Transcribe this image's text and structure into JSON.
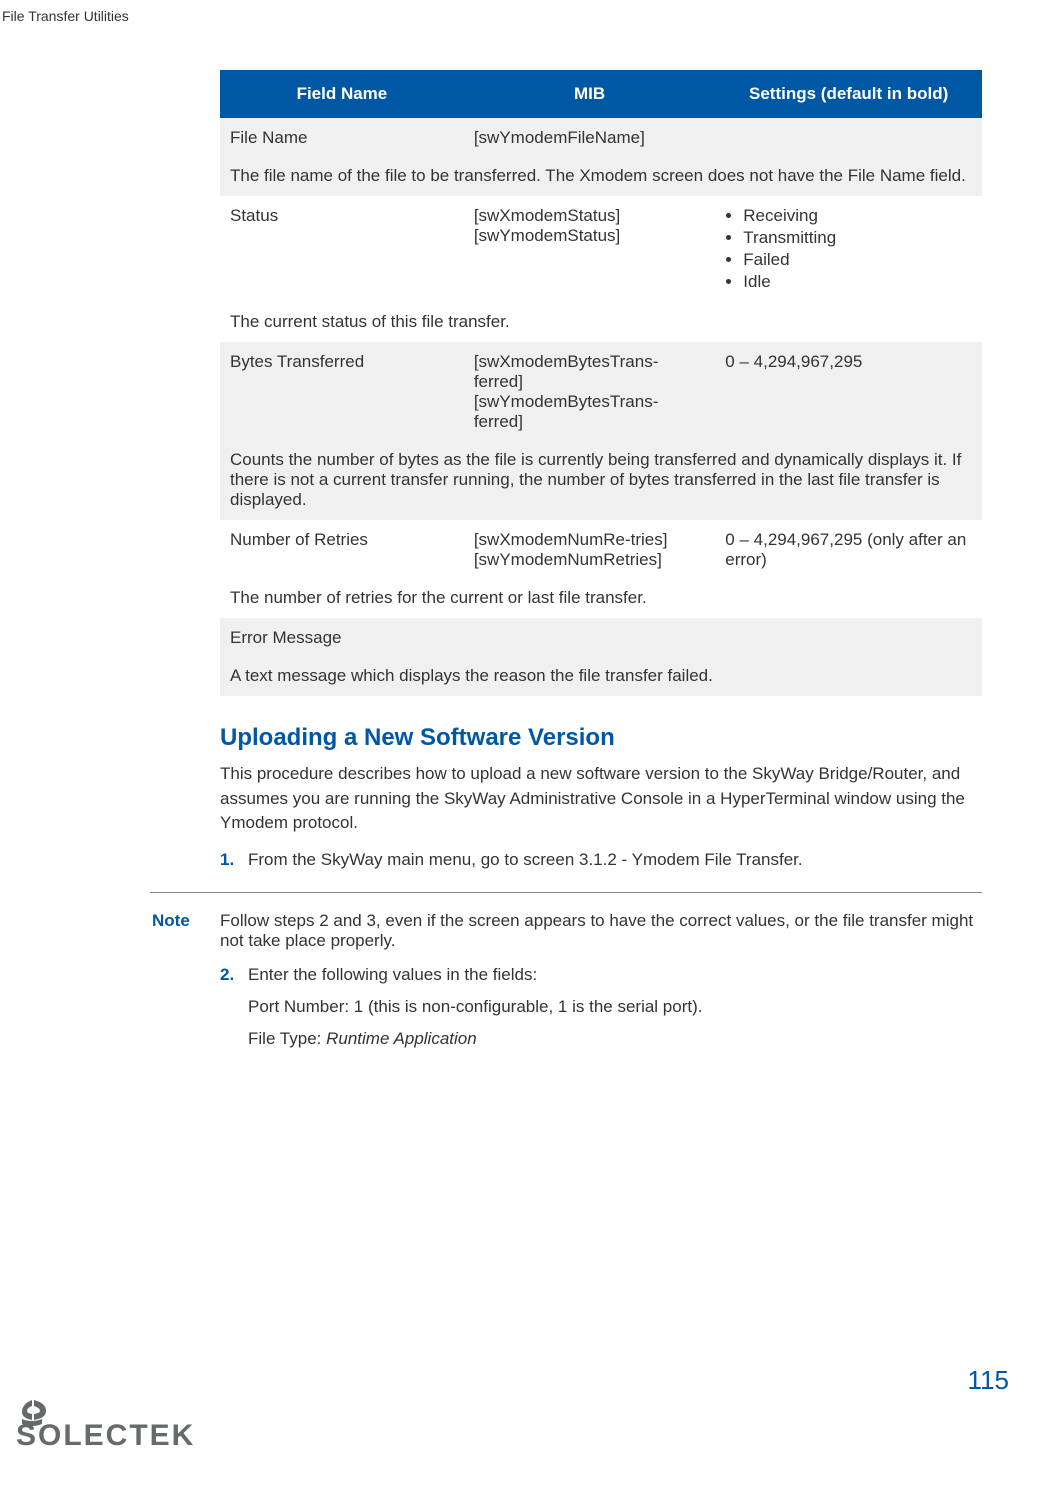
{
  "header": {
    "title": "File Transfer Utilities"
  },
  "table": {
    "headers": {
      "field": "Field Name",
      "mib": "MIB",
      "settings": "Settings (default in bold)"
    },
    "rows": {
      "r1": {
        "field": "File Name",
        "mib": "[swYmodemFileName]",
        "settings": "",
        "desc": "The file name of the file to be transferred. The Xmodem screen does not have the File Name field."
      },
      "r2": {
        "field": "Status",
        "mib": "[swXmodemStatus] [swYmodemStatus]",
        "bullets": {
          "b1": "Receiving",
          "b2": "Transmitting",
          "b3": "Failed",
          "b4": "Idle"
        },
        "desc": "The current status of this file transfer."
      },
      "r3": {
        "field": "Bytes Transferred",
        "mib": "[swXmodemBytesTrans-ferred] [swYmodemBytesTrans-ferred]",
        "settings": "0 – 4,294,967,295",
        "desc": "Counts the number of bytes as the file is currently being transferred and dynamically displays it. If there is not a current transfer running, the number of bytes transferred in the last file transfer is displayed."
      },
      "r4": {
        "field": "Number of Retries",
        "mib": "[swXmodemNumRe-tries] [swYmodemNumRetries]",
        "settings": "0 – 4,294,967,295 (only after an error)",
        "desc": "The number of retries for the current or last file transfer."
      },
      "r5": {
        "field": "Error Message",
        "desc": "A text message which displays the reason the file transfer failed."
      }
    }
  },
  "section": {
    "title": "Uploading a New Software Version",
    "intro": "This procedure describes how to upload a new software version to the SkyWay Bridge/Router, and assumes you are running the SkyWay Administrative Console in a HyperTerminal window using the Ymodem protocol.",
    "steps": {
      "s1": {
        "num": "1.",
        "text": "From the SkyWay main menu, go to screen 3.1.2 - Ymodem File Transfer."
      },
      "s2": {
        "num": "2.",
        "text": "Enter the following values in the fields:",
        "sub1": "Port Number: 1 (this is non-configurable, 1 is the serial port).",
        "sub2pre": "File Type:  ",
        "sub2it": "Runtime Application"
      }
    },
    "note": {
      "label": "Note",
      "text": "Follow steps 2 and 3, even if the screen appears to have the correct values, or the file transfer might not take place properly."
    }
  },
  "footer": {
    "page": "115",
    "logo": "SOLECTEK"
  }
}
